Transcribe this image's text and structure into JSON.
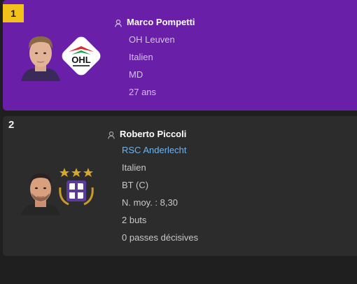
{
  "players": [
    {
      "rank": "1",
      "name": "Marco Pompetti",
      "club": "OH Leuven",
      "nationality": "Italien",
      "position": "MD",
      "age": "27 ans",
      "club_logo_icon": "oh-leuven-logo",
      "accent_color": "#6a1fa8",
      "badge_color": "#f2c21b"
    },
    {
      "rank": "2",
      "name": "Roberto Piccoli",
      "club": "RSC Anderlecht",
      "nationality": "Italien",
      "position": "BT (C)",
      "avg_rating": "N. moy. : 8,30",
      "goals": "2 buts",
      "assists": "0 passes décisives",
      "club_logo_icon": "rsc-anderlecht-logo",
      "club_link_color": "#6fb4ee"
    }
  ]
}
